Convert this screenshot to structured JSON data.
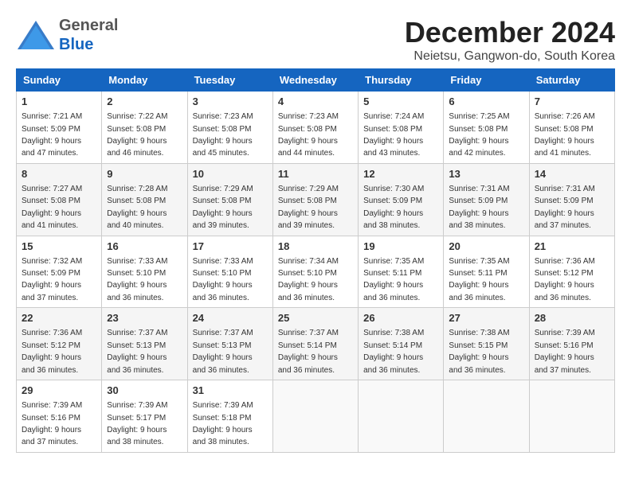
{
  "header": {
    "logo_general": "General",
    "logo_blue": "Blue",
    "month_title": "December 2024",
    "subtitle": "Neietsu, Gangwon-do, South Korea"
  },
  "calendar": {
    "headers": [
      "Sunday",
      "Monday",
      "Tuesday",
      "Wednesday",
      "Thursday",
      "Friday",
      "Saturday"
    ],
    "weeks": [
      [
        {
          "day": "1",
          "sunrise": "Sunrise: 7:21 AM",
          "sunset": "Sunset: 5:09 PM",
          "daylight": "Daylight: 9 hours and 47 minutes."
        },
        {
          "day": "2",
          "sunrise": "Sunrise: 7:22 AM",
          "sunset": "Sunset: 5:08 PM",
          "daylight": "Daylight: 9 hours and 46 minutes."
        },
        {
          "day": "3",
          "sunrise": "Sunrise: 7:23 AM",
          "sunset": "Sunset: 5:08 PM",
          "daylight": "Daylight: 9 hours and 45 minutes."
        },
        {
          "day": "4",
          "sunrise": "Sunrise: 7:23 AM",
          "sunset": "Sunset: 5:08 PM",
          "daylight": "Daylight: 9 hours and 44 minutes."
        },
        {
          "day": "5",
          "sunrise": "Sunrise: 7:24 AM",
          "sunset": "Sunset: 5:08 PM",
          "daylight": "Daylight: 9 hours and 43 minutes."
        },
        {
          "day": "6",
          "sunrise": "Sunrise: 7:25 AM",
          "sunset": "Sunset: 5:08 PM",
          "daylight": "Daylight: 9 hours and 42 minutes."
        },
        {
          "day": "7",
          "sunrise": "Sunrise: 7:26 AM",
          "sunset": "Sunset: 5:08 PM",
          "daylight": "Daylight: 9 hours and 41 minutes."
        }
      ],
      [
        {
          "day": "8",
          "sunrise": "Sunrise: 7:27 AM",
          "sunset": "Sunset: 5:08 PM",
          "daylight": "Daylight: 9 hours and 41 minutes."
        },
        {
          "day": "9",
          "sunrise": "Sunrise: 7:28 AM",
          "sunset": "Sunset: 5:08 PM",
          "daylight": "Daylight: 9 hours and 40 minutes."
        },
        {
          "day": "10",
          "sunrise": "Sunrise: 7:29 AM",
          "sunset": "Sunset: 5:08 PM",
          "daylight": "Daylight: 9 hours and 39 minutes."
        },
        {
          "day": "11",
          "sunrise": "Sunrise: 7:29 AM",
          "sunset": "Sunset: 5:08 PM",
          "daylight": "Daylight: 9 hours and 39 minutes."
        },
        {
          "day": "12",
          "sunrise": "Sunrise: 7:30 AM",
          "sunset": "Sunset: 5:09 PM",
          "daylight": "Daylight: 9 hours and 38 minutes."
        },
        {
          "day": "13",
          "sunrise": "Sunrise: 7:31 AM",
          "sunset": "Sunset: 5:09 PM",
          "daylight": "Daylight: 9 hours and 38 minutes."
        },
        {
          "day": "14",
          "sunrise": "Sunrise: 7:31 AM",
          "sunset": "Sunset: 5:09 PM",
          "daylight": "Daylight: 9 hours and 37 minutes."
        }
      ],
      [
        {
          "day": "15",
          "sunrise": "Sunrise: 7:32 AM",
          "sunset": "Sunset: 5:09 PM",
          "daylight": "Daylight: 9 hours and 37 minutes."
        },
        {
          "day": "16",
          "sunrise": "Sunrise: 7:33 AM",
          "sunset": "Sunset: 5:10 PM",
          "daylight": "Daylight: 9 hours and 36 minutes."
        },
        {
          "day": "17",
          "sunrise": "Sunrise: 7:33 AM",
          "sunset": "Sunset: 5:10 PM",
          "daylight": "Daylight: 9 hours and 36 minutes."
        },
        {
          "day": "18",
          "sunrise": "Sunrise: 7:34 AM",
          "sunset": "Sunset: 5:10 PM",
          "daylight": "Daylight: 9 hours and 36 minutes."
        },
        {
          "day": "19",
          "sunrise": "Sunrise: 7:35 AM",
          "sunset": "Sunset: 5:11 PM",
          "daylight": "Daylight: 9 hours and 36 minutes."
        },
        {
          "day": "20",
          "sunrise": "Sunrise: 7:35 AM",
          "sunset": "Sunset: 5:11 PM",
          "daylight": "Daylight: 9 hours and 36 minutes."
        },
        {
          "day": "21",
          "sunrise": "Sunrise: 7:36 AM",
          "sunset": "Sunset: 5:12 PM",
          "daylight": "Daylight: 9 hours and 36 minutes."
        }
      ],
      [
        {
          "day": "22",
          "sunrise": "Sunrise: 7:36 AM",
          "sunset": "Sunset: 5:12 PM",
          "daylight": "Daylight: 9 hours and 36 minutes."
        },
        {
          "day": "23",
          "sunrise": "Sunrise: 7:37 AM",
          "sunset": "Sunset: 5:13 PM",
          "daylight": "Daylight: 9 hours and 36 minutes."
        },
        {
          "day": "24",
          "sunrise": "Sunrise: 7:37 AM",
          "sunset": "Sunset: 5:13 PM",
          "daylight": "Daylight: 9 hours and 36 minutes."
        },
        {
          "day": "25",
          "sunrise": "Sunrise: 7:37 AM",
          "sunset": "Sunset: 5:14 PM",
          "daylight": "Daylight: 9 hours and 36 minutes."
        },
        {
          "day": "26",
          "sunrise": "Sunrise: 7:38 AM",
          "sunset": "Sunset: 5:14 PM",
          "daylight": "Daylight: 9 hours and 36 minutes."
        },
        {
          "day": "27",
          "sunrise": "Sunrise: 7:38 AM",
          "sunset": "Sunset: 5:15 PM",
          "daylight": "Daylight: 9 hours and 36 minutes."
        },
        {
          "day": "28",
          "sunrise": "Sunrise: 7:39 AM",
          "sunset": "Sunset: 5:16 PM",
          "daylight": "Daylight: 9 hours and 37 minutes."
        }
      ],
      [
        {
          "day": "29",
          "sunrise": "Sunrise: 7:39 AM",
          "sunset": "Sunset: 5:16 PM",
          "daylight": "Daylight: 9 hours and 37 minutes."
        },
        {
          "day": "30",
          "sunrise": "Sunrise: 7:39 AM",
          "sunset": "Sunset: 5:17 PM",
          "daylight": "Daylight: 9 hours and 38 minutes."
        },
        {
          "day": "31",
          "sunrise": "Sunrise: 7:39 AM",
          "sunset": "Sunset: 5:18 PM",
          "daylight": "Daylight: 9 hours and 38 minutes."
        },
        null,
        null,
        null,
        null
      ]
    ]
  }
}
